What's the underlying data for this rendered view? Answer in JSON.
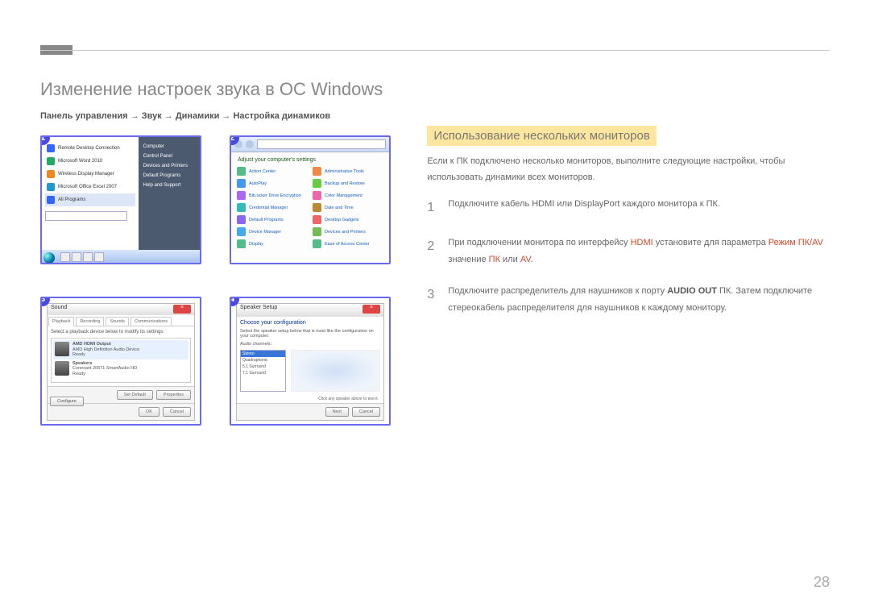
{
  "page_number": "28",
  "main_title": "Изменение настроек звука в ОС Windows",
  "path": "Панель управления → Звук → Динамики → Настройка динамиков",
  "badges": [
    "1",
    "2",
    "3",
    "4"
  ],
  "start_menu": {
    "left_items": [
      "Remote Desktop Connection",
      "Microsoft Word 2010",
      "Wireless Display Manager",
      "Microsoft Office Excel 2007",
      "All Programs"
    ],
    "right_items": [
      "Computer",
      "Control Panel",
      "Devices and Printers",
      "Default Programs",
      "Help and Support"
    ]
  },
  "control_panel": {
    "heading": "Adjust your computer's settings",
    "items": [
      "Action Center",
      "Administrative Tools",
      "AutoPlay",
      "Backup and Restore",
      "BitLocker Drive Encryption",
      "Color Management",
      "Credential Manager",
      "Date and Time",
      "Default Programs",
      "Desktop Gadgets",
      "Device Manager",
      "Devices and Printers",
      "Display",
      "Ease of Access Center"
    ]
  },
  "sound_dialog": {
    "title": "Sound",
    "tabs": [
      "Playback",
      "Recording",
      "Sounds",
      "Communications"
    ],
    "instruction": "Select a playback device below to modify its settings:",
    "device_name": "AMD HDMI Output",
    "device_sub1": "AMD High Definition Audio Device",
    "device_sub2": "Ready",
    "device2_name": "Speakers",
    "device2_sub1": "Conexant 20671 SmartAudio HD",
    "device2_sub2": "Ready",
    "btn_configure": "Configure",
    "btn_setdefault": "Set Default",
    "btn_properties": "Properties",
    "btn_ok": "OK",
    "btn_cancel": "Cancel"
  },
  "speaker_setup": {
    "title": "Speaker Setup",
    "heading": "Choose your configuration",
    "sub": "Select the speaker setup below that is most like the configuration on your computer.",
    "label": "Audio channels:",
    "options": [
      "Stereo",
      "Quadraphonic",
      "5.1 Surround",
      "7.1 Surround"
    ],
    "test_note": "Click any speaker above to test it.",
    "btn_next": "Next",
    "btn_cancel": "Cancel"
  },
  "right": {
    "section_title": "Использование нескольких мониторов",
    "intro": "Если к ПК подключено несколько мониторов, выполните следующие настройки, чтобы использовать динамики всех мониторов.",
    "steps": [
      {
        "num": "1",
        "text_parts": [
          {
            "t": "Подключите кабель HDMI или DisplayPort каждого монитора к ПК."
          }
        ]
      },
      {
        "num": "2",
        "text_parts": [
          {
            "t": "При подключении монитора по интерфейсу "
          },
          {
            "t": "HDMI",
            "cls": "hl-red"
          },
          {
            "t": " установите для параметра "
          },
          {
            "t": "Режим ПК/AV",
            "cls": "hl-red"
          },
          {
            "t": " значение "
          },
          {
            "t": "ПК",
            "cls": "hl-red"
          },
          {
            "t": " или "
          },
          {
            "t": "AV",
            "cls": "hl-red"
          },
          {
            "t": "."
          }
        ]
      },
      {
        "num": "3",
        "text_parts": [
          {
            "t": "Подключите распределитель для наушников к порту "
          },
          {
            "t": "AUDIO OUT",
            "cls": "hl-bold"
          },
          {
            "t": " ПК. Затем подключите стереокабель распределителя для наушников к каждому монитору."
          }
        ]
      }
    ]
  }
}
